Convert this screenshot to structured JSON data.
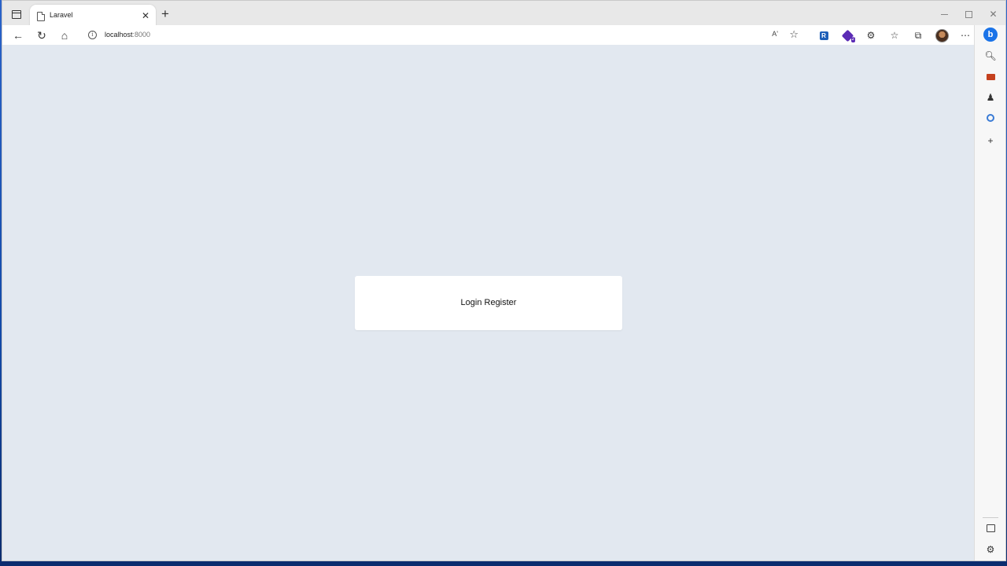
{
  "browser": {
    "tab": {
      "title": "Laravel"
    },
    "address": {
      "host": "localhost",
      "port": ":8000"
    },
    "icons": {
      "tab_actions": "tab-actions-icon",
      "close": "close-icon",
      "new_tab": "plus-icon",
      "back": "back-arrow-icon",
      "refresh": "refresh-icon",
      "home": "home-icon",
      "info": "info-icon",
      "read_aloud": "read-aloud-icon",
      "favorite": "star-icon"
    },
    "read_aloud_label": "Aʹ",
    "extensions_badge": "2"
  },
  "page": {
    "links_text": "Login Register",
    "background_color": "#e2e8f0",
    "card_color": "#ffffff"
  },
  "sidebar": {
    "bing_label": "b",
    "items": [
      "search-icon",
      "toolbox-icon",
      "games-icon",
      "office-icon",
      "add-icon"
    ]
  }
}
